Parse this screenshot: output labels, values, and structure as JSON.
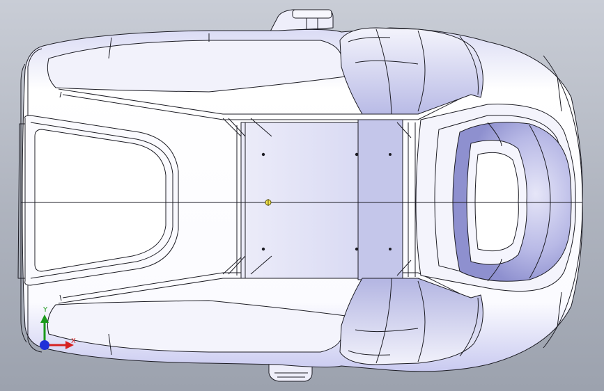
{
  "viewport": {
    "background_top": "#c9cdd6",
    "background_bottom": "#9ca2ae",
    "model_fill": "#f7f7fd",
    "model_shadow": "#b7b8e4",
    "edge_color": "#1c1c24"
  },
  "triad": {
    "x_label": "X",
    "y_label": "Y",
    "x_color": "#d62020",
    "y_color": "#1a9a1a",
    "z_color": "#2030d8"
  }
}
